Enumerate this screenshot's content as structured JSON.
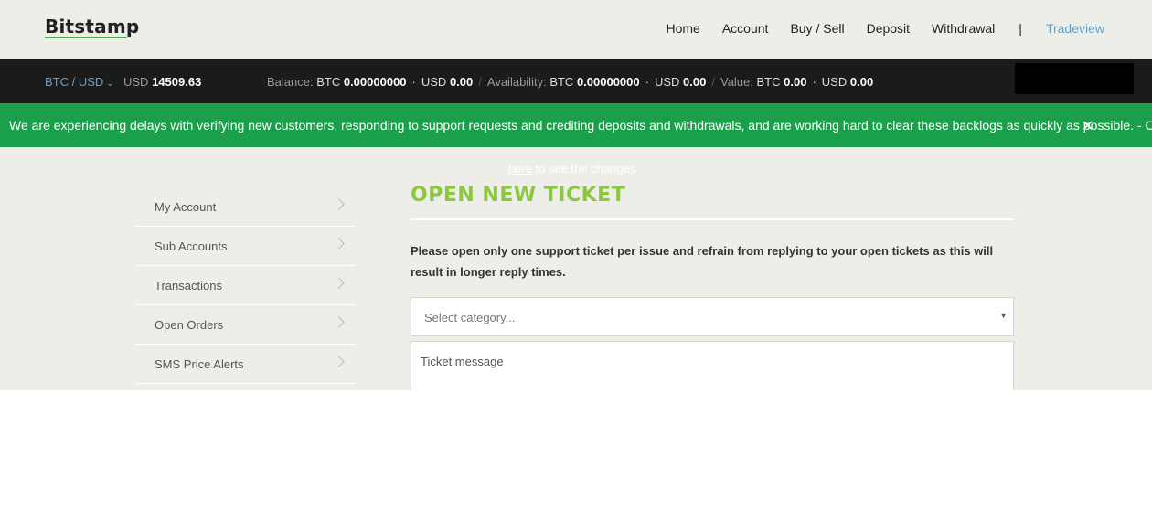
{
  "header": {
    "logo": "Bitstamp",
    "nav": [
      "Home",
      "Account",
      "Buy / Sell",
      "Deposit",
      "Withdrawal"
    ],
    "separator": "|",
    "tradeview": "Tradeview"
  },
  "ticker": {
    "pair": "BTC / USD",
    "price_currency": "USD",
    "price": "14509.63",
    "balance_label": "Balance:",
    "balance_btc_label": "BTC",
    "balance_btc": "0.00000000",
    "balance_usd_label": "USD",
    "balance_usd": "0.00",
    "availability_label": "Availability:",
    "availability_btc_label": "BTC",
    "availability_btc": "0.00000000",
    "availability_usd_label": "USD",
    "availability_usd": "0.00",
    "value_label": "Value:",
    "value_btc_label": "BTC",
    "value_btc": "0.00",
    "value_usd_label": "USD",
    "value_usd": "0.00"
  },
  "banner": {
    "message": "We are experiencing delays with verifying new customers, responding to support requests and crediting deposits and withdrawals, and are working hard to clear these backlogs as quickly as possible. - Click",
    "close": "✕",
    "link_text": "here",
    "continuation": " to see the changes"
  },
  "sidebar": {
    "items": [
      "My Account",
      "Sub Accounts",
      "Transactions",
      "Open Orders",
      "SMS Price Alerts"
    ]
  },
  "main": {
    "title": "OPEN NEW TICKET",
    "notice": "Please open only one support ticket per issue and refrain from replying to your open tickets as this will result in longer reply times.",
    "category_placeholder": "Select category...",
    "message_placeholder": "Ticket message"
  },
  "colors": {
    "banner_green": "#1aa04b",
    "title_green": "#8dc63f",
    "link_blue": "#5aa3d8"
  }
}
